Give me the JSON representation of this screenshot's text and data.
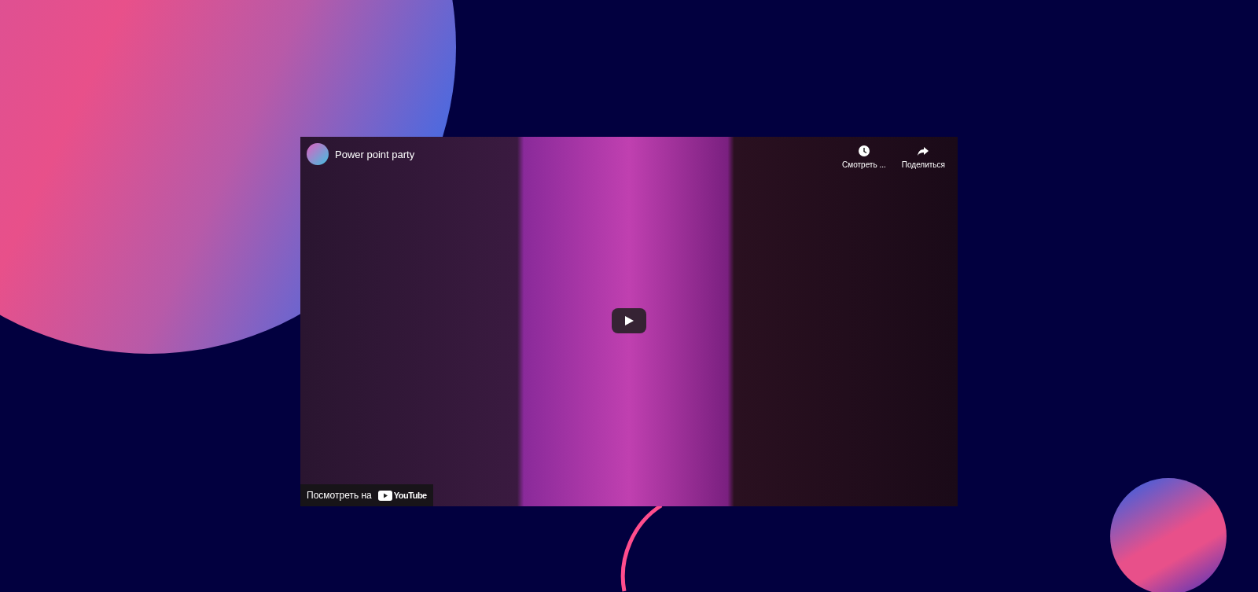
{
  "video": {
    "title": "Power point party",
    "actions": [
      {
        "kind": "watch-later",
        "label": "Смотреть ..."
      },
      {
        "kind": "share",
        "label": "Поделиться"
      }
    ],
    "watch_on": {
      "label": "Посмотреть на",
      "logo_text": "YouTube"
    }
  }
}
